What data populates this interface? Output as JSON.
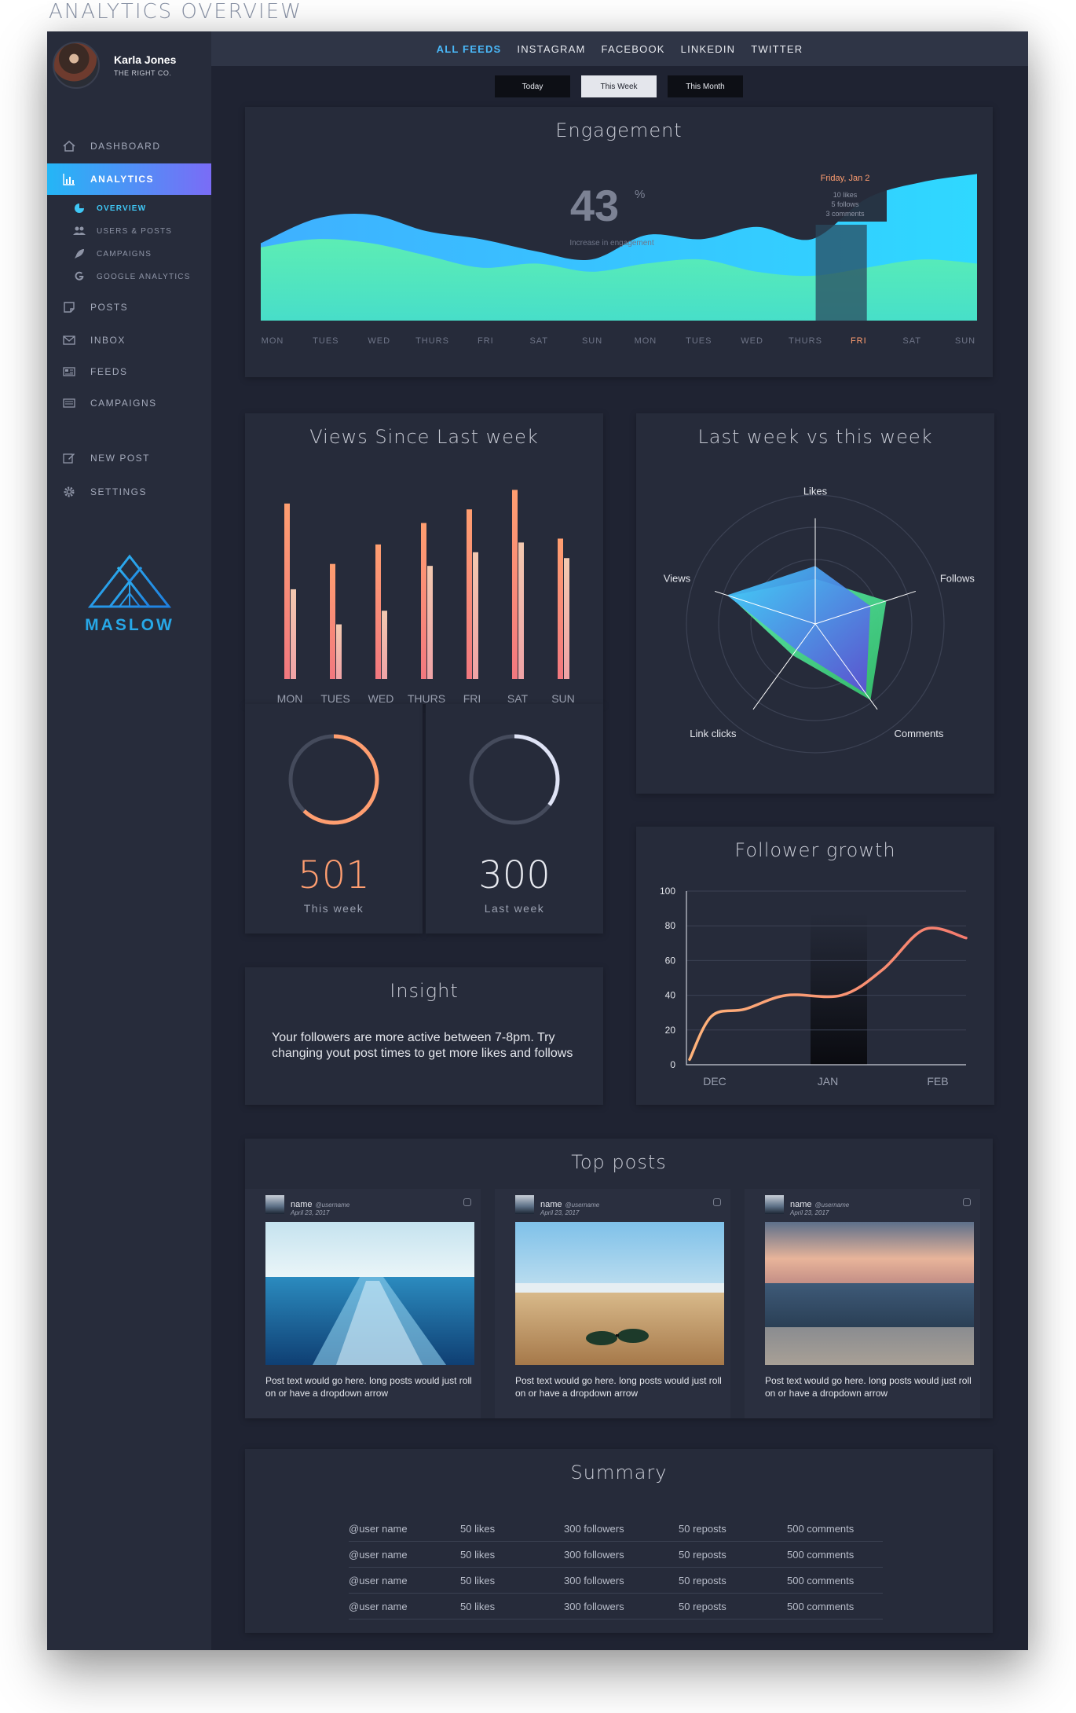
{
  "page_heading": "ANALYTICS OVERVIEW",
  "profile": {
    "name": "Karla Jones",
    "company": "THE RIGHT CO."
  },
  "nav": {
    "dashboard": "DASHBOARD",
    "analytics": "ANALYTICS",
    "sub": {
      "overview": "OVERVIEW",
      "users_posts": "USERS & POSTS",
      "campaigns": "CAMPAIGNS",
      "google": "GOOGLE ANALYTICS"
    },
    "posts": "POSTS",
    "inbox": "INBOX",
    "feeds": "FEEDS",
    "campaigns": "CAMPAIGNS",
    "new_post": "NEW POST",
    "settings": "SETTINGS"
  },
  "logo": {
    "text": "MASLOW"
  },
  "feed_tabs": [
    "ALL FEEDS",
    "INSTAGRAM",
    "FACEBOOK",
    "LINKEDIN",
    "TWITTER"
  ],
  "ranges": [
    "Today",
    "This Week",
    "This Month"
  ],
  "colors": {
    "accent_cyan": "#3fd0ff",
    "accent_green": "#5ef0b0",
    "orange": "#ff9e70",
    "bg": "#1f2332",
    "card": "#262b3a"
  },
  "engagement": {
    "title": "Engagement",
    "value": "43",
    "unit": "%",
    "caption": "Increase in engagement",
    "tooltip": {
      "day": "Friday, Jan 2",
      "likes": "10 likes",
      "follows": "5 follows",
      "comments": "3 comments"
    },
    "days": [
      "MON",
      "TUES",
      "WED",
      "THURS",
      "FRI",
      "SAT",
      "SUN",
      "MON",
      "TUES",
      "WED",
      "THURS",
      "FRI",
      "SAT",
      "SUN"
    ],
    "highlight_day": 11,
    "series": [
      {
        "values": [
          38,
          50,
          52,
          44,
          40,
          34,
          30,
          42,
          40,
          46,
          40,
          60,
          68,
          72
        ]
      },
      {
        "values": [
          36,
          40,
          38,
          32,
          26,
          28,
          24,
          28,
          30,
          24,
          22,
          26,
          30,
          28
        ]
      }
    ]
  },
  "views": {
    "title": "Views Since Last week",
    "chart_data": {
      "type": "bar",
      "categories": [
        "MON",
        "TUES",
        "WED",
        "THURS",
        "FRI",
        "SAT",
        "SUN"
      ],
      "series": [
        {
          "values": [
            90,
            59,
            69,
            80,
            87,
            97,
            72
          ]
        },
        {
          "values": [
            46,
            28,
            35,
            58,
            65,
            70,
            62
          ]
        }
      ],
      "ylim": [
        0,
        100
      ]
    }
  },
  "stats": [
    {
      "value": "501",
      "label": "This week",
      "fraction": 0.62,
      "color": "#ff9e70"
    },
    {
      "value": "300",
      "label": "Last week",
      "fraction": 0.35,
      "color": "#dfe3f5"
    }
  ],
  "radar": {
    "title": "Last week vs this week",
    "chart_data": {
      "type": "radar",
      "axes": [
        "Likes",
        "Follows",
        "Comments",
        "Link clicks",
        "Views"
      ],
      "series": [
        {
          "values": [
            0.35,
            0.58,
            0.73,
            0.3,
            0.7
          ]
        },
        {
          "values": [
            0.45,
            0.45,
            0.67,
            0.25,
            0.72
          ]
        }
      ]
    }
  },
  "follower": {
    "title": "Follower growth",
    "chart_data": {
      "type": "line",
      "xlabels": [
        "DEC",
        "JAN",
        "FEB"
      ],
      "yticks": [
        0,
        20,
        40,
        60,
        80,
        100
      ],
      "ylim": [
        0,
        100
      ],
      "points": [
        [
          0,
          3
        ],
        [
          0.08,
          28
        ],
        [
          0.2,
          32
        ],
        [
          0.35,
          40
        ],
        [
          0.55,
          40
        ],
        [
          0.7,
          55
        ],
        [
          0.85,
          78
        ],
        [
          1.0,
          73
        ]
      ]
    }
  },
  "insight": {
    "title": "Insight",
    "text": "Your followers are more active between 7-8pm. Try changing yout post times to get more likes and follows"
  },
  "top_posts": {
    "title": "Top posts",
    "posts": [
      {
        "name": "name",
        "user": "@username",
        "date": "April 23, 2017",
        "text": "Post text would go here. long posts would just roll on or have a dropdown arrow"
      },
      {
        "name": "name",
        "user": "@username",
        "date": "April 23, 2017",
        "text": "Post text would go here. long posts would just roll on or have a dropdown arrow"
      },
      {
        "name": "name",
        "user": "@username",
        "date": "April 23, 2017",
        "text": "Post text would go here. long posts would just roll on or have a dropdown arrow"
      }
    ]
  },
  "summary": {
    "title": "Summary",
    "rows": [
      [
        "@user name",
        "50 likes",
        "300 followers",
        "50 reposts",
        "500 comments"
      ],
      [
        "@user name",
        "50 likes",
        "300 followers",
        "50 reposts",
        "500 comments"
      ],
      [
        "@user name",
        "50 likes",
        "300 followers",
        "50 reposts",
        "500 comments"
      ],
      [
        "@user name",
        "50 likes",
        "300 followers",
        "50 reposts",
        "500 comments"
      ]
    ]
  }
}
